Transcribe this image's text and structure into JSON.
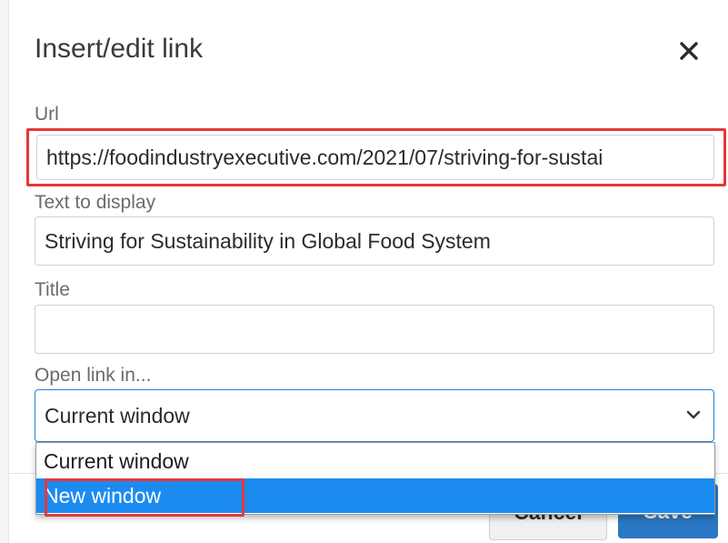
{
  "dialog": {
    "title": "Insert/edit link",
    "close_icon": "close-icon"
  },
  "fields": {
    "url": {
      "label": "Url",
      "value": "https://foodindustryexecutive.com/2021/07/striving-for-sustai"
    },
    "text_to_display": {
      "label": "Text to display",
      "value": "Striving for Sustainability in Global Food System"
    },
    "title": {
      "label": "Title",
      "value": ""
    },
    "open_link_in": {
      "label": "Open link in...",
      "selected": "Current window",
      "options": [
        "Current window",
        "New window"
      ],
      "highlighted_option": "New window"
    }
  },
  "buttons": {
    "cancel": "Cancel",
    "save": "Save"
  },
  "colors": {
    "accent": "#2a78c4",
    "option_highlight": "#1c8bf0",
    "annotation_red": "#e5373a"
  }
}
